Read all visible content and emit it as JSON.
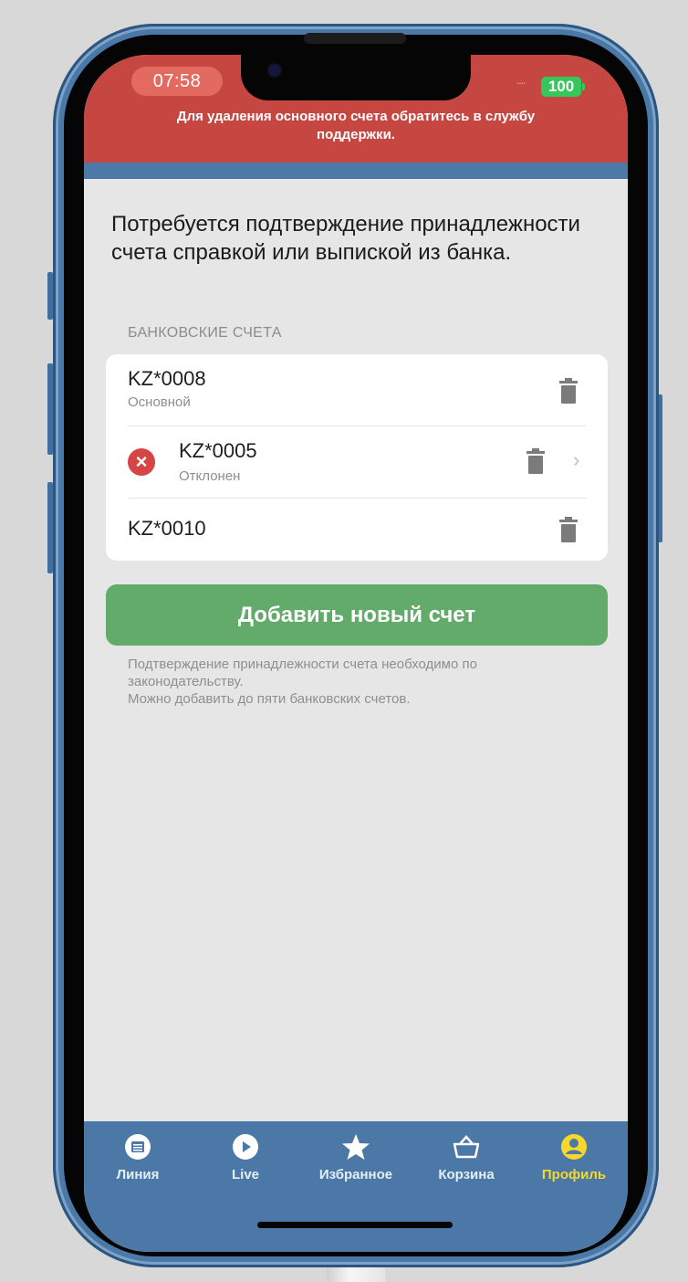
{
  "status_bar": {
    "time": "07:58",
    "signal": "....",
    "battery": "100"
  },
  "banner": {
    "message": "Для удаления основного счета обратитесь в службу поддержки."
  },
  "main": {
    "headline": "Потребуется подтверждение принадлежности счета справкой или выпиской из банка.",
    "section_label": "БАНКОВСКИЕ СЧЕТА",
    "accounts": [
      {
        "number": "KZ*0008",
        "status": "Основной"
      },
      {
        "number": "KZ*0005",
        "status": "Отклонен"
      },
      {
        "number": "KZ*0010",
        "status": ""
      }
    ],
    "add_button": "Добавить новый счет",
    "note_line1": "Подтверждение принадлежности счета необходимо по законодательству.",
    "note_line2": "Можно добавить до пяти банковских счетов."
  },
  "tabbar": {
    "items": [
      {
        "label": "Линия",
        "icon": "calendar-icon"
      },
      {
        "label": "Live",
        "icon": "play-icon"
      },
      {
        "label": "Избранное",
        "icon": "star-icon"
      },
      {
        "label": "Корзина",
        "icon": "basket-icon"
      },
      {
        "label": "Профиль",
        "icon": "profile-icon"
      }
    ],
    "active_color": "#f6d82b"
  },
  "colors": {
    "banner": "#c64741",
    "accent_green": "#62ab6a",
    "tabbar": "#4b78a7",
    "error": "#d54545"
  }
}
